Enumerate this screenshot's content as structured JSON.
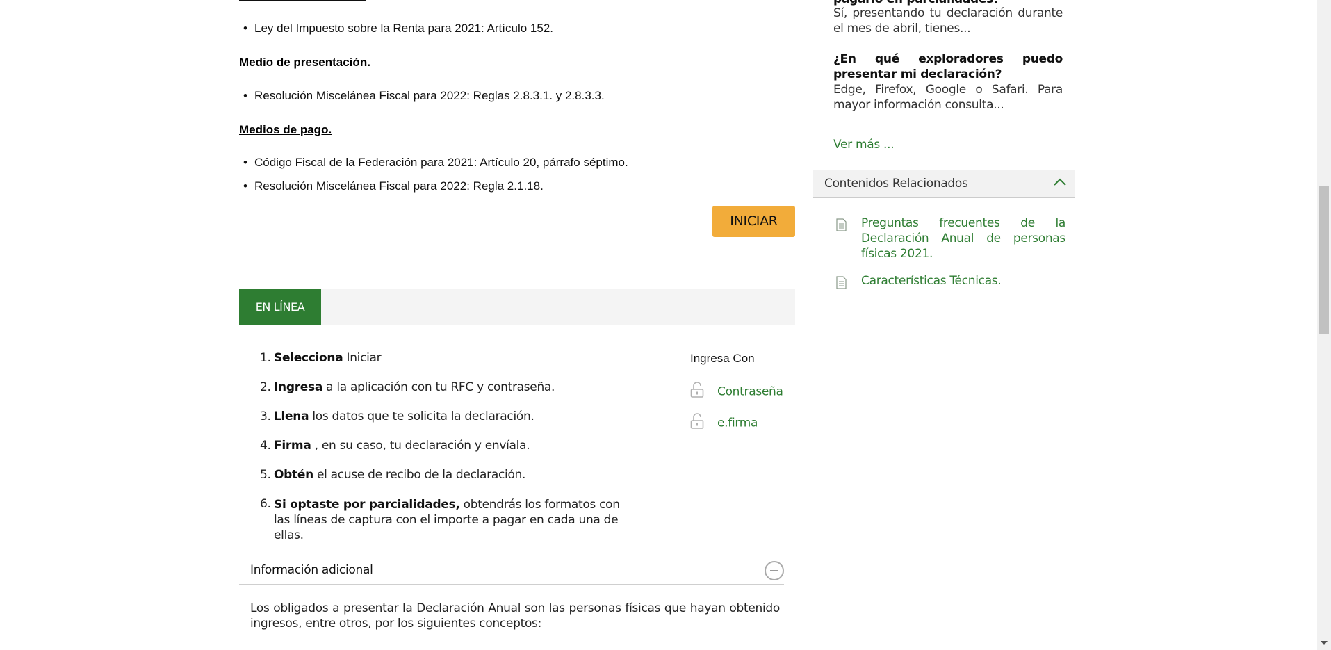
{
  "main": {
    "legal": {
      "item_ley": "Ley del Impuesto sobre la Renta para 2021: Artículo 152.",
      "heading_medio": "Medio de presentación.",
      "item_rmf_presentacion": "Resolución Miscelánea Fiscal para 2022: Reglas 2.8.3.1.  y 2.8.3.3.",
      "heading_pago": "Medios de pago.",
      "item_cff": "Código Fiscal de la Federación para 2021: Artículo 20, párrafo séptimo.",
      "item_rmf_pago": "Resolución Miscelánea Fiscal para 2022: Regla 2.1.18.",
      "bullet": "•"
    },
    "iniciar_label": "INICIAR",
    "tab_label": "EN LÍNEA",
    "steps": [
      {
        "num": "1.",
        "bold": "Selecciona",
        "rest": " Iniciar"
      },
      {
        "num": "2.",
        "bold": "Ingresa",
        "rest": " a la aplicación con tu RFC y contraseña."
      },
      {
        "num": "3.",
        "bold": "Llena",
        "rest": " los datos que te solicita la declaración."
      },
      {
        "num": "4.",
        "bold": "Firma",
        "rest": " , en su caso, tu declaración y envíala."
      },
      {
        "num": "5.",
        "bold": "Obtén",
        "rest": " el acuse de recibo de la declaración."
      },
      {
        "num": "6.",
        "bold": "Si optaste por parcialidades,",
        "rest": " obtendrás los formatos con las líneas de captura con el importe a pagar en cada una de ellas."
      }
    ],
    "ingresa": {
      "title": "Ingresa Con",
      "contrasena": "Contraseña",
      "efirma": "e.firma"
    },
    "info": {
      "title": "Información adicional",
      "text": "Los obligados a presentar la Declaración Anual son las personas físicas que hayan obtenido ingresos, entre otros, por los siguientes conceptos:"
    }
  },
  "sidebar": {
    "faq1_q_tail": "pagarlo en parcialidades?",
    "faq1_a": "Sí, presentando tu declaración durante el mes de abril, tienes...",
    "faq2_q": "¿En qué exploradores puedo presentar mi declaración?",
    "faq2_a": "Edge, Firefox, Google o Safari.  Para mayor información consulta...",
    "ver_mas": "Ver más ...",
    "related_title": "Contenidos Relacionados",
    "related": [
      "Preguntas frecuentes de la Declaración Anual de personas físicas 2021.",
      "Características Técnicas."
    ]
  },
  "colors": {
    "green": "#2e7d32",
    "button_orange": "#f2ac3a"
  },
  "icons": {
    "lock": "lock-open-icon",
    "doc": "document-icon",
    "chevron": "chevron-up-icon",
    "collapse": "minus-circle-icon"
  }
}
